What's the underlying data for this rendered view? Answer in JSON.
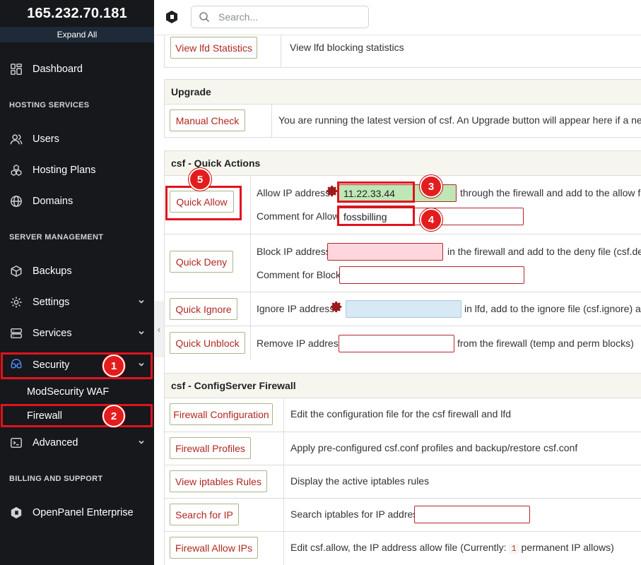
{
  "sidebar": {
    "server_ip": "165.232.70.181",
    "expand_all": "Expand All",
    "sections": {
      "hosting": "HOSTING SERVICES",
      "server": "SERVER MANAGEMENT",
      "billing": "BILLING AND SUPPORT"
    },
    "items": {
      "dashboard": "Dashboard",
      "users": "Users",
      "hosting_plans": "Hosting Plans",
      "domains": "Domains",
      "backups": "Backups",
      "settings": "Settings",
      "services": "Services",
      "security": "Security",
      "modsecurity": "ModSecurity WAF",
      "firewall": "Firewall",
      "advanced": "Advanced",
      "openpanel_enterprise": "OpenPanel Enterprise"
    },
    "badges": [
      "1",
      "2"
    ]
  },
  "topbar": {
    "search_placeholder": "Search..."
  },
  "content": {
    "lfd_stats": {
      "button": "View lfd Statistics",
      "desc": "View lfd blocking statistics"
    },
    "upgrade": {
      "title": "Upgrade",
      "button": "Manual Check",
      "desc": "You are running the latest version of csf. An Upgrade button will appear here if a new version"
    },
    "quick_actions": {
      "title": "csf - Quick Actions",
      "allow": {
        "button": "Quick Allow",
        "label_ip": "Allow IP address",
        "ip_value": "11.22.33.44",
        "suffix": "through the firewall and add to the allow file (c",
        "label_comment": "Comment for Allow:",
        "comment_value": "fossbilling"
      },
      "deny": {
        "button": "Quick Deny",
        "label_ip": "Block IP address",
        "suffix": "in the firewall and add to the deny file (csf.deny).",
        "label_comment": "Comment for Block:"
      },
      "ignore": {
        "button": "Quick Ignore",
        "label_ip": "Ignore IP address",
        "suffix": "in lfd, add to the ignore file (csf.ignore) and r"
      },
      "unblock": {
        "button": "Quick Unblock",
        "label_ip": "Remove IP address",
        "suffix": "from the firewall (temp and perm blocks)"
      },
      "badges": [
        "3",
        "4",
        "5"
      ]
    },
    "configserver": {
      "title": "csf - ConfigServer Firewall",
      "rows": [
        {
          "button": "Firewall Configuration",
          "desc": "Edit the configuration file for the csf firewall and lfd"
        },
        {
          "button": "Firewall Profiles",
          "desc": "Apply pre-configured csf.conf profiles and backup/restore csf.conf"
        },
        {
          "button": "View iptables Rules",
          "desc": "Display the active iptables rules"
        },
        {
          "button": "Search for IP",
          "desc": "Search iptables for IP address"
        },
        {
          "button": "Firewall Allow IPs",
          "desc_pre": "Edit csf.allow, the IP address allow file (Currently:",
          "count": "1",
          "desc_post": "permanent IP allows)"
        }
      ]
    }
  },
  "colors": {
    "sidebar_bg": "#16181c",
    "highlight_red": "#e0131c",
    "button_text": "#b0281f",
    "panel_header_bg": "#f6f6ee"
  }
}
